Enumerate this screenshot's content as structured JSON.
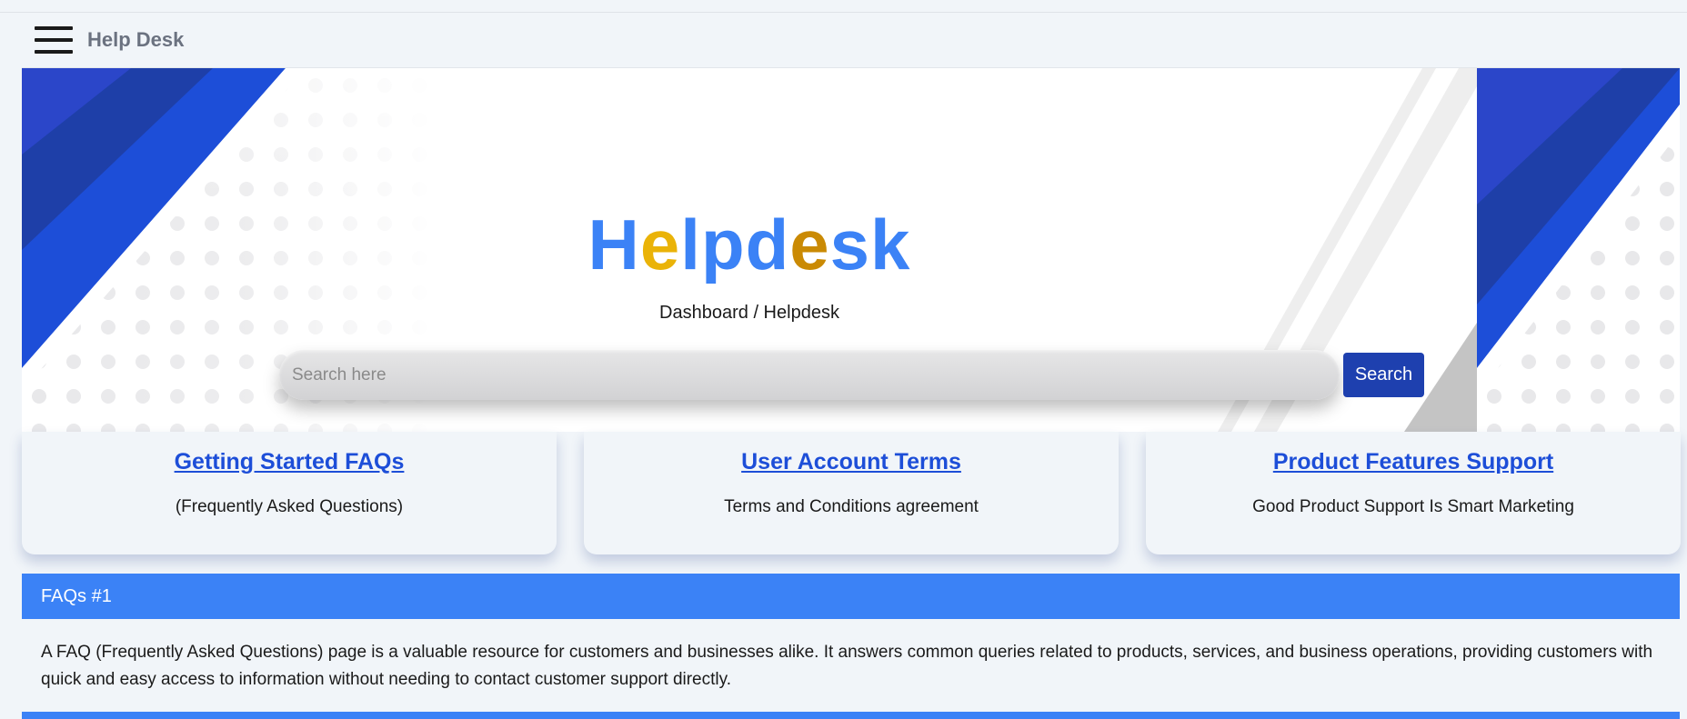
{
  "appbar": {
    "title": "Help Desk"
  },
  "hero": {
    "title_letters": [
      {
        "ch": "H",
        "tone": "b"
      },
      {
        "ch": "e",
        "tone": "y"
      },
      {
        "ch": "l",
        "tone": "b"
      },
      {
        "ch": "p",
        "tone": "b"
      },
      {
        "ch": "d",
        "tone": "b"
      },
      {
        "ch": "e",
        "tone": "o"
      },
      {
        "ch": "s",
        "tone": "b"
      },
      {
        "ch": "k",
        "tone": "b"
      }
    ],
    "breadcrumb": "Dashboard / Helpdesk"
  },
  "search": {
    "placeholder": "Search here",
    "button_label": "Search"
  },
  "cards": [
    {
      "title": "Getting Started FAQs",
      "subtitle": "(Frequently Asked Questions)"
    },
    {
      "title": "User Account Terms",
      "subtitle": "Terms and Conditions agreement"
    },
    {
      "title": "Product Features Support",
      "subtitle": "Good Product Support Is Smart Marketing"
    }
  ],
  "faq": {
    "heading": "FAQs #1",
    "body": "A FAQ (Frequently Asked Questions) page is a valuable resource for customers and businesses alike. It answers common queries related to products, services, and business operations, providing customers with quick and easy access to information without needing to contact customer support directly."
  },
  "colors": {
    "brand_blue": "#3b82f6",
    "dark_blue": "#1e40af",
    "link_blue": "#1d4ed8",
    "yellow": "#eab308",
    "dark_yellow": "#ca8a04"
  }
}
